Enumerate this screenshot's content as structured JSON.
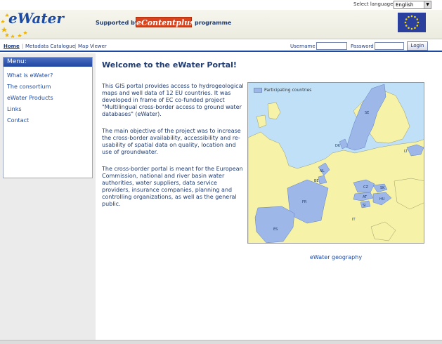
{
  "top": {
    "select_language_label": "Select language",
    "language_value": "English"
  },
  "header": {
    "logo_text": "eWater",
    "supported_by": "Supported by",
    "econtent": "eContentplus",
    "programme": "programme"
  },
  "nav": {
    "home": "Home",
    "metadata": "Metadata Catalogue",
    "map": "Map Viewer",
    "username_label": "Username",
    "password_label": "Password",
    "login_label": "Login"
  },
  "menu": {
    "title": "Menu:",
    "items": [
      "What is eWater?",
      "The consortium",
      "eWater Products",
      "Links",
      "Contact"
    ]
  },
  "main": {
    "title": "Welcome to the eWater Portal!",
    "paragraphs": [
      "This GIS portal provides access to hydrogeological maps and well data of 12 EU countries. It was developed in frame of EC co-funded project \"Multilingual cross-border access to ground water databases\" (eWater).",
      "The main objective of the project was to increase the cross-border availability, accessibility and re-usability of spatial data on quality, location and use of groundwater.",
      "The cross-border portal is meant for the European Commission, national and river basin water authorities, water suppliers, data service providers, insurance companies, planning and controlling organizations, as well as the general public."
    ],
    "map_legend": "Participating countries",
    "map_caption": "eWater geography",
    "country_labels": [
      "SE",
      "LT",
      "DK",
      "NL",
      "BE",
      "FR",
      "CZ",
      "SK",
      "AT",
      "SI",
      "HU",
      "IT",
      "ES"
    ]
  },
  "colors": {
    "brand_blue": "#1c4aa3",
    "text_navy": "#1e3a6e",
    "participating": "#9db7e9",
    "land": "#f6f3a8",
    "sea": "#bfe0f7",
    "econtent_red": "#d9421b"
  }
}
